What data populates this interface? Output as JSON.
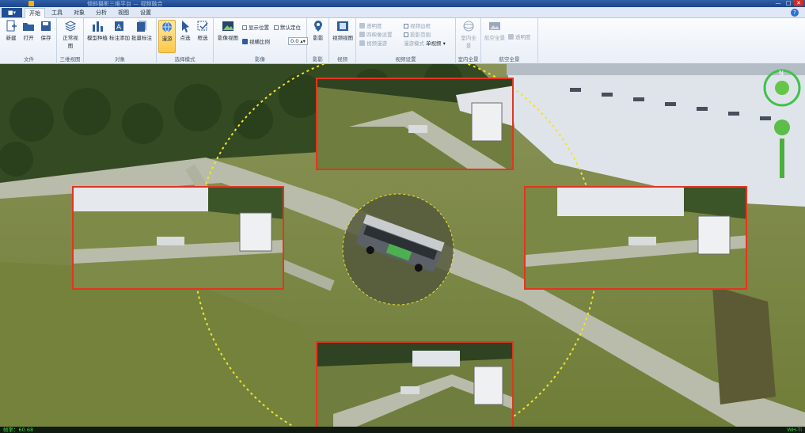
{
  "window": {
    "title": "倾斜摄影三维平台 — 视频融合",
    "minimize": "—",
    "maximize": "□",
    "close": "✕"
  },
  "tabs": {
    "app_menu": "■▾",
    "items": [
      "开始",
      "工具",
      "对象",
      "分析",
      "视图",
      "设置"
    ],
    "active": "开始",
    "help": "?"
  },
  "ribbon": {
    "file": {
      "label": "文件",
      "new": "新建",
      "open": "打开",
      "save": "保存"
    },
    "view3d": {
      "label": "三维视图",
      "normal": "正常视图"
    },
    "object": {
      "label": "对象",
      "model_type": "模型种植",
      "add_label": "标注添加",
      "batch_label": "批量标注"
    },
    "select_mode": {
      "label": "选择模式",
      "roam": "漫游",
      "point_select": "点选",
      "box_select": "框选"
    },
    "imagery": {
      "label": "影像",
      "image_view": "影像视图",
      "show_position": "显示位置",
      "default_position": "默认定位",
      "view_ratio": "视横比例",
      "ratio_value": "0.0"
    },
    "shadow": {
      "label": "影影",
      "btn": "影影"
    },
    "video": {
      "label": "视频",
      "video_view": "视频视图"
    },
    "video_settings": {
      "label": "视频设置",
      "transparency": "透明度",
      "video_border": "视频边框",
      "project_settings": "四映像设置",
      "projection_range": "投影范围",
      "video_scan": "视频漫游",
      "scan_mode_label": "漫游模式",
      "scan_mode_value": "单视频"
    },
    "indoor": {
      "label": "室内全景",
      "btn": "室内全景"
    },
    "aerial": {
      "label": "航空全景",
      "btn": "航空全景",
      "transparency": "透明度"
    }
  },
  "status": {
    "left": "帧率：60.68",
    "right": "WH-Ti"
  },
  "compass": {
    "north": "N"
  }
}
